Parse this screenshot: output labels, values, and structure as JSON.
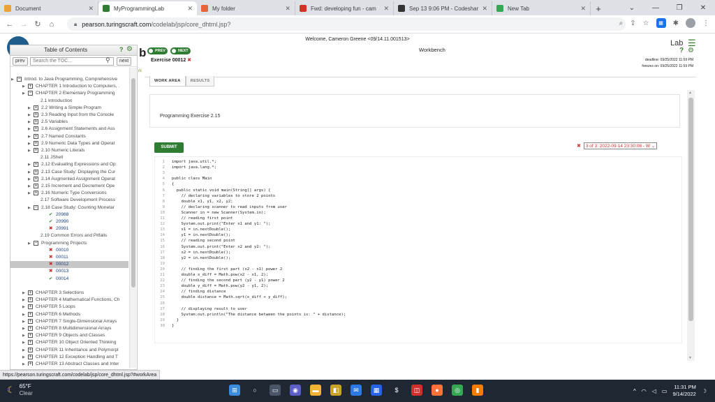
{
  "browser": {
    "tabs": [
      {
        "title": "Document",
        "icon": "document-icon",
        "color": "#e8a33d",
        "active": false
      },
      {
        "title": "MyProgrammingLab",
        "icon": "myprogramminglab-icon",
        "color": "#2e7d32",
        "active": true
      },
      {
        "title": "My folder",
        "icon": "folder-icon",
        "color": "#e8643a",
        "active": false
      },
      {
        "title": "Fwd: developing fun - cam",
        "icon": "gmail-icon",
        "color": "#d93025",
        "active": false
      },
      {
        "title": "Sep 13 9:06 PM - Codeshar",
        "icon": "codeshare-icon",
        "color": "#333333",
        "active": false
      },
      {
        "title": "New Tab",
        "icon": "chrome-icon",
        "color": "#34a853",
        "active": false
      }
    ],
    "new_tab": "+",
    "url_host": "pearson.turingscraft.com",
    "url_path": "/codelab/jsp/core_dhtml.jsp?"
  },
  "page": {
    "welcome": "Welcome, Cameron Greene <09/14.11.001513>"
  },
  "toc": {
    "title": "Table of Contents",
    "prev": "prev",
    "next": "next",
    "search_placeholder": "Search the TOC..."
  },
  "toc_items": [
    {
      "type": "root",
      "text": "Introd. to Java Programming, Comprehensive"
    },
    {
      "type": "chapter",
      "text": "CHAPTER 1 Introduction to Computers, ."
    },
    {
      "type": "chapter-open",
      "text": "CHAPTER 2 Elementary Programming"
    },
    {
      "type": "leaf",
      "text": "2.1 Introduction"
    },
    {
      "type": "section",
      "text": "2.2 Writing a Simple Program"
    },
    {
      "type": "section",
      "text": "2.3 Reading Input from the Console"
    },
    {
      "type": "section",
      "text": "2.5 Variables"
    },
    {
      "type": "section",
      "text": "2.6 Assignment Statements and Ass"
    },
    {
      "type": "section",
      "text": "2.7 Named Constants"
    },
    {
      "type": "section",
      "text": "2.9 Numeric Data Types and Operat"
    },
    {
      "type": "section",
      "text": "2.10 Numeric Literals"
    },
    {
      "type": "leaf",
      "text": "2.11 JShell"
    },
    {
      "type": "section",
      "text": "2.12 Evaluating Expressions and Op"
    },
    {
      "type": "section",
      "text": "2.13 Case Study: Displaying the Cur"
    },
    {
      "type": "section",
      "text": "2.14 Augmented Assignment Operat"
    },
    {
      "type": "section",
      "text": "2.15 Increment and Decrement Ope"
    },
    {
      "type": "section",
      "text": "2.16 Numeric Type Conversions"
    },
    {
      "type": "leaf",
      "text": "2.17 Software Development Process"
    },
    {
      "type": "section-open",
      "text": "2.18 Case Study: Counting Monetar"
    },
    {
      "type": "ok",
      "text": "20988"
    },
    {
      "type": "ok",
      "text": "20990"
    },
    {
      "type": "bad",
      "text": "20991"
    },
    {
      "type": "leaf",
      "text": "2.19 Common Errors and Pitfalls"
    },
    {
      "type": "section-open",
      "text": "Programming Projects"
    },
    {
      "type": "bad",
      "text": "00010"
    },
    {
      "type": "bad",
      "text": "00011"
    },
    {
      "type": "bad-sel",
      "text": "00012"
    },
    {
      "type": "bad",
      "text": "00013"
    },
    {
      "type": "ok",
      "text": "00014"
    },
    {
      "type": "gap",
      "text": ""
    },
    {
      "type": "chapter",
      "text": "CHAPTER 3 Selections"
    },
    {
      "type": "chapter",
      "text": "CHAPTER 4 Mathematical Functions, Ch"
    },
    {
      "type": "chapter",
      "text": "CHAPTER 5 Loops"
    },
    {
      "type": "chapter",
      "text": "CHAPTER 6 Methods"
    },
    {
      "type": "chapter",
      "text": "CHAPTER 7 Single-Dimensional Arrays"
    },
    {
      "type": "chapter",
      "text": "CHAPTER 8 Multidimensional Arrays"
    },
    {
      "type": "chapter",
      "text": "CHAPTER 9 Objects and Classes"
    },
    {
      "type": "chapter",
      "text": "CHAPTER 10 Object Oriented Thinking"
    },
    {
      "type": "chapter",
      "text": "CHAPTER 11 Inheritance and Polymorpl"
    },
    {
      "type": "chapter",
      "text": "CHAPTER 12 Exception Handling and T"
    },
    {
      "type": "chapter",
      "text": "CHAPTER 13 Abstract Classes and Inter"
    },
    {
      "type": "chapleaf",
      "text": "CHAPTER 14 JavaFX Basics"
    },
    {
      "type": "chapter",
      "text": "CHAPTER 15 Event Driven Programmin"
    }
  ],
  "header": {
    "big_letter": "b",
    "rii": "rii",
    "prev_pill": "PREV",
    "next_pill": "NEXT",
    "exercise": "Exercise 00012",
    "exercise_mark": "✖",
    "workbench": "Workbench",
    "lab": "Lab",
    "deadline": "deadline: 09/25/2022 11:59 PM",
    "freezes": "freezes on: 09/25/2022 11:59 PM"
  },
  "tabs": {
    "work_area": "WORK AREA",
    "results": "RESULTS"
  },
  "prompt": "Programming Exercise 2.15",
  "submit": "SUBMIT",
  "submission": {
    "mark": "✖",
    "selected": "3 of 3: 2022-09-14 23:30:08 - W"
  },
  "code": [
    "import java.util.*;",
    "import java.lang.*;",
    "",
    "public class Main",
    "{",
    "  public static void main(String[] args) {",
    "    // declaring variables to store 2 points",
    "    double x1, y1, x2, y2;",
    "    // declaring scanner to read inputs from user",
    "    Scanner in = new Scanner(System.in);",
    "    // reading first point",
    "    System.out.print(\"Enter x1 and y1: \");",
    "    x1 = in.nextDouble();",
    "    y1 = in.nextDouble();",
    "    // reading second point",
    "    System.out.print(\"Enter x2 and y2: \");",
    "    x2 = in.nextDouble();",
    "    y2 = in.nextDouble();",
    "",
    "    // finding the first part (x2 - x1) power 2",
    "    double x_diff = Math.pow(x2 - x1, 2);",
    "    // finding the second part (y2 - y1) power 2",
    "    double y_diff = Math.pow(y2 - y1, 2);",
    "    // finding distance",
    "    double distance = Math.sqrt(x_diff + y_diff);",
    "",
    "    // displaying result to user",
    "    System.out.println(\"The distance between the points is: \" + distance);",
    "  }",
    "}"
  ],
  "status_url": "https://pearson.turingscraft.com/codelab/jsp/core_dhtml.jsp?#workArea",
  "taskbar": {
    "temp": "65°F",
    "weather": "Clear",
    "time": "11:31 PM",
    "date": "9/14/2022"
  }
}
